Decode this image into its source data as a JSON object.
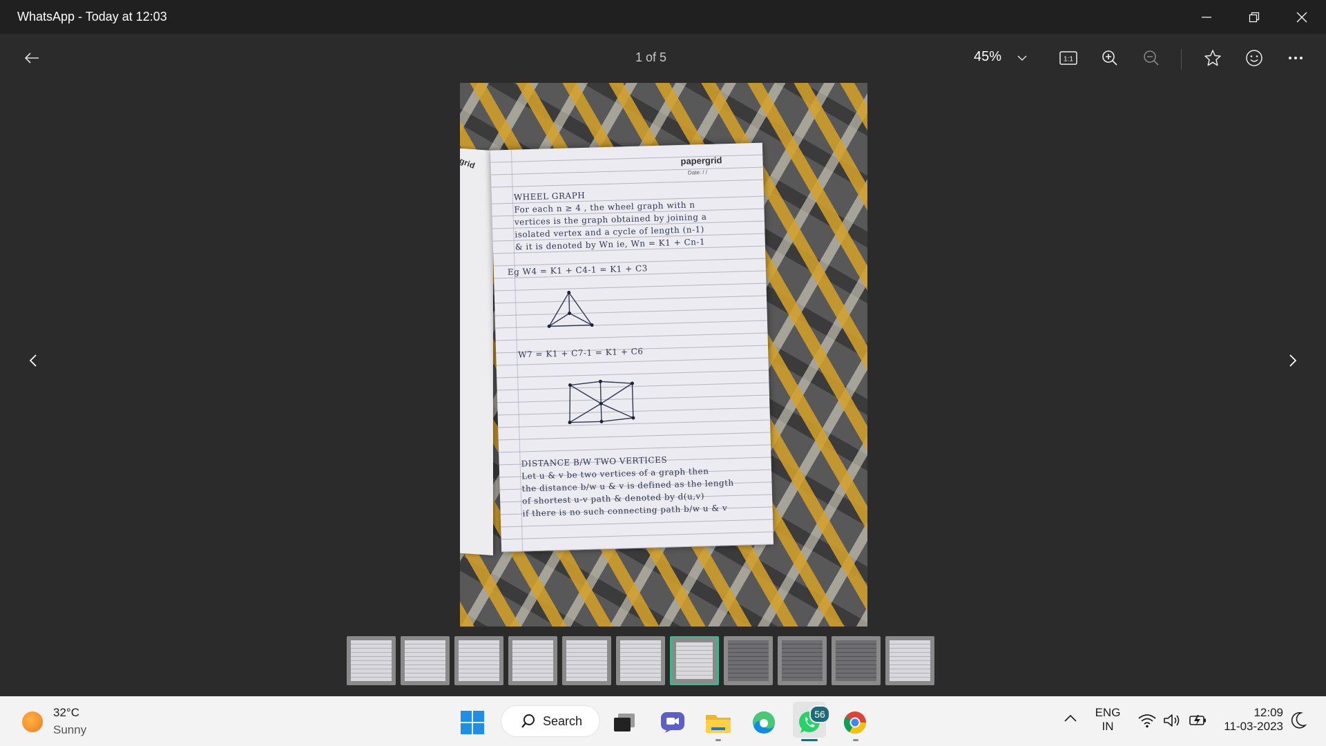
{
  "window": {
    "title": "WhatsApp - Today at 12:03",
    "controls": [
      "minimize-icon",
      "restore-icon",
      "close-icon"
    ]
  },
  "toolbar": {
    "page_indicator": "1 of 5",
    "zoom": "45%",
    "icons": [
      "back-arrow-icon",
      "chevron-down-icon",
      "actual-size-icon",
      "zoom-in-icon",
      "zoom-out-icon",
      "star-icon",
      "emoji-icon",
      "more-icon"
    ],
    "actual_size_label": "1:1"
  },
  "photo": {
    "brand": "papergrid",
    "date_label": "Date:   /   /",
    "left_page_label": "ergrid",
    "notes": [
      "WHEEL GRAPH",
      "For each n ≥ 4 , the wheel graph with n",
      "vertices is the graph obtained by joining a",
      "isolated vertex and a cycle of length (n-1)",
      "& it is denoted by Wn ie, Wn = K1 + Cn-1",
      "Eg   W4 = K1 + C4-1 = K1 + C3",
      "W7 = K1 + C7-1 = K1 + C6",
      "DISTANCE B/W TWO VERTICES",
      "Let u & v be two vertices of a graph then",
      "the distance b/w u & v is defined as the length",
      "of shortest u-v path & denoted by d(u,v)",
      "if there is no such connecting path b/w u & v"
    ]
  },
  "filmstrip": {
    "count": 11,
    "selected_index": 6
  },
  "taskbar": {
    "weather": {
      "temp": "32°C",
      "condition": "Sunny",
      "icon": "sun-icon"
    },
    "search_label": "Search",
    "whatsapp_badge": "56",
    "apps": [
      "start-icon",
      "task-view-icon",
      "teams-icon",
      "file-explorer-icon",
      "edge-icon",
      "whatsapp-icon",
      "chrome-icon"
    ],
    "lang_top": "ENG",
    "lang_bottom": "IN",
    "time": "12:09",
    "date": "11-03-2023"
  },
  "colors": {
    "titlebar": "#202020",
    "background": "#2b2b2b",
    "taskbar": "#f3f3f3",
    "selected_thumb": "#3fb58f"
  }
}
